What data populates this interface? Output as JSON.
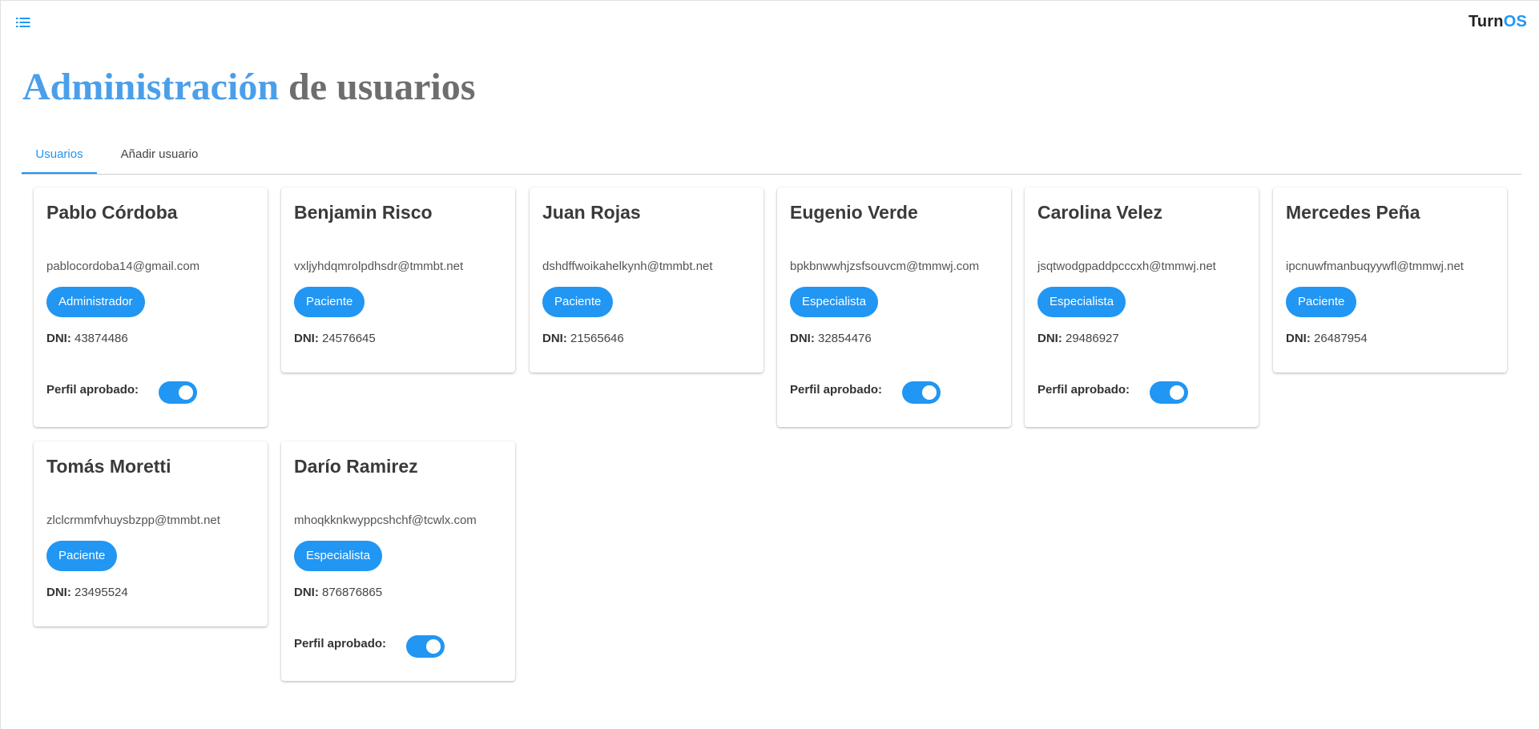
{
  "app": {
    "brand_part1": "Turn",
    "brand_part2": "OS",
    "menu_icon": "list-menu-icon"
  },
  "page": {
    "title_part1": "Administración",
    "title_part2": "de usuarios"
  },
  "tabs": [
    {
      "label": "Usuarios",
      "active": true
    },
    {
      "label": "Añadir usuario",
      "active": false
    }
  ],
  "labels": {
    "dni": "DNI:",
    "approved": "Perfil aprobado:"
  },
  "users": [
    {
      "name": "Pablo Córdoba",
      "email": "pablocordoba14@gmail.com",
      "role": "Administrador",
      "dni": "43874486",
      "approved": true
    },
    {
      "name": "Benjamin Risco",
      "email": "vxljyhdqmrolpdhsdr@tmmbt.net",
      "role": "Paciente",
      "dni": "24576645",
      "approved": null
    },
    {
      "name": "Juan Rojas",
      "email": "dshdffwoikahelkynh@tmmbt.net",
      "role": "Paciente",
      "dni": "21565646",
      "approved": null
    },
    {
      "name": "Eugenio Verde",
      "email": "bpkbnwwhjzsfsouvcm@tmmwj.com",
      "role": "Especialista",
      "dni": "32854476",
      "approved": true
    },
    {
      "name": "Carolina Velez",
      "email": "jsqtwodgpaddpcccxh@tmmwj.net",
      "role": "Especialista",
      "dni": "29486927",
      "approved": true
    },
    {
      "name": "Mercedes Peña",
      "email": "ipcnuwfmanbuqyywfl@tmmwj.net",
      "role": "Paciente",
      "dni": "26487954",
      "approved": null
    },
    {
      "name": "Tomás Moretti",
      "email": "zlclcrmmfvhuysbzpp@tmmbt.net",
      "role": "Paciente",
      "dni": "23495524",
      "approved": null
    },
    {
      "name": "Darío Ramirez",
      "email": "mhoqkknkwyppcshchf@tcwlx.com",
      "role": "Especialista",
      "dni": "876876865",
      "approved": true
    }
  ],
  "colors": {
    "accent": "#2196f3",
    "title_accent": "#4a9fea",
    "title_muted": "#6e6e6e"
  }
}
